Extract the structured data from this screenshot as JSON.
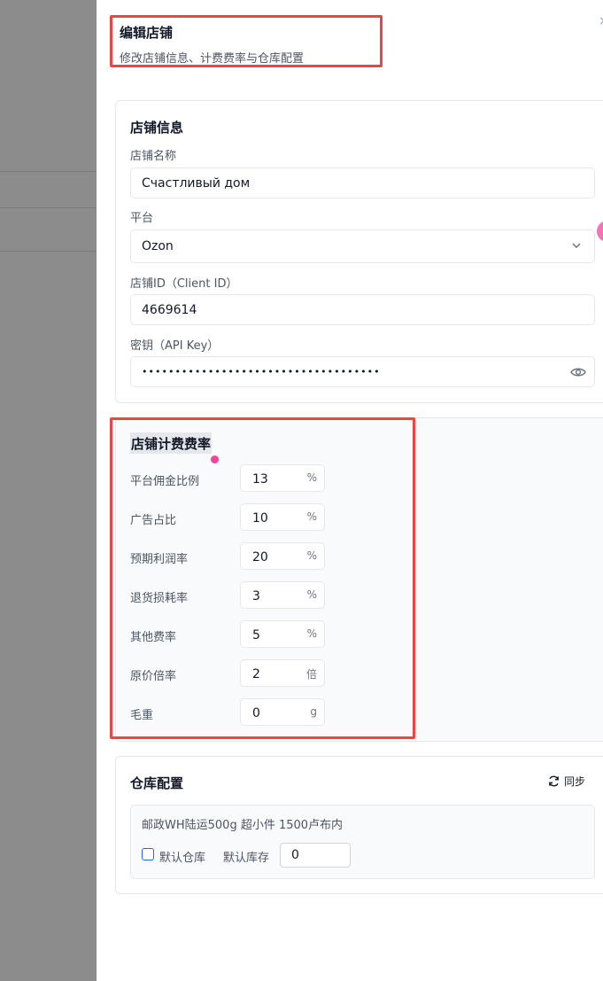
{
  "drawer": {
    "title": "编辑店铺",
    "description": "修改店铺信息、计费费率与仓库配置",
    "close_icon": "×"
  },
  "store_info": {
    "title": "店铺信息",
    "name_label": "店铺名称",
    "name_value": "Счастливый дом",
    "platform_label": "平台",
    "platform_value": "Ozon",
    "client_id_label": "店铺ID（Client ID）",
    "client_id_value": "4669614",
    "api_key_label": "密钥（API Key）",
    "api_key_value": "••••••••••••••••••••••••••••••••••••"
  },
  "fees": {
    "title": "店铺计费费率",
    "items": [
      {
        "label": "平台佣金比例",
        "value": "13",
        "unit": "%"
      },
      {
        "label": "广告占比",
        "value": "10",
        "unit": "%"
      },
      {
        "label": "预期利润率",
        "value": "20",
        "unit": "%"
      },
      {
        "label": "退货损耗率",
        "value": "3",
        "unit": "%"
      },
      {
        "label": "其他费率",
        "value": "5",
        "unit": "%"
      },
      {
        "label": "原价倍率",
        "value": "2",
        "unit": "倍"
      },
      {
        "label": "毛重",
        "value": "0",
        "unit": "g"
      }
    ]
  },
  "warehouse": {
    "title": "仓库配置",
    "sync_label": "同步",
    "name": "邮政WH陆运500g 超小件 1500卢布内",
    "default_label": "默认仓库",
    "stock_label": "默认库存",
    "stock_value": "0"
  },
  "colors": {
    "highlight_border": "#ef4444",
    "checkbox": "#2563eb",
    "pink_dot": "#ec4899"
  }
}
